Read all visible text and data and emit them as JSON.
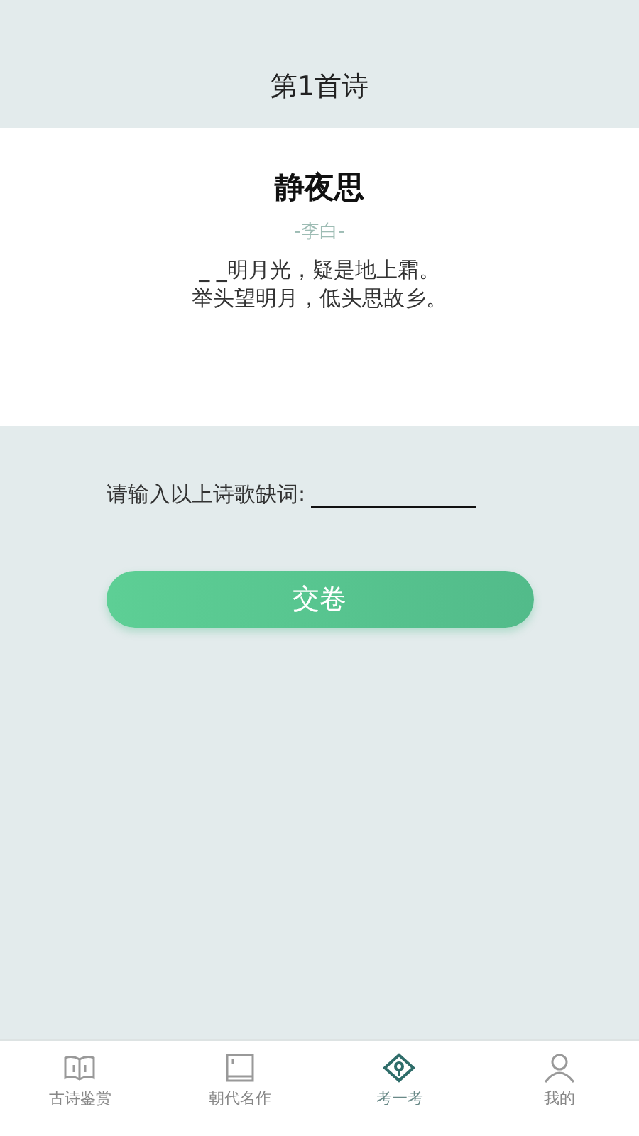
{
  "header": {
    "title": "第1首诗"
  },
  "poem": {
    "title": "静夜思",
    "author": "-李白-",
    "lines": [
      "_ _明月光，疑是地上霜。",
      "举头望明月，低头思故乡。"
    ]
  },
  "answer": {
    "label": "请输入以上诗歌缺词:"
  },
  "submit": {
    "label": "交卷"
  },
  "tabs": [
    {
      "label": "古诗鉴赏",
      "kind": "book",
      "selected": false
    },
    {
      "label": "朝代名作",
      "kind": "frame",
      "selected": false
    },
    {
      "label": "考一考",
      "kind": "pen",
      "selected": true
    },
    {
      "label": "我的",
      "kind": "person",
      "selected": false
    }
  ]
}
